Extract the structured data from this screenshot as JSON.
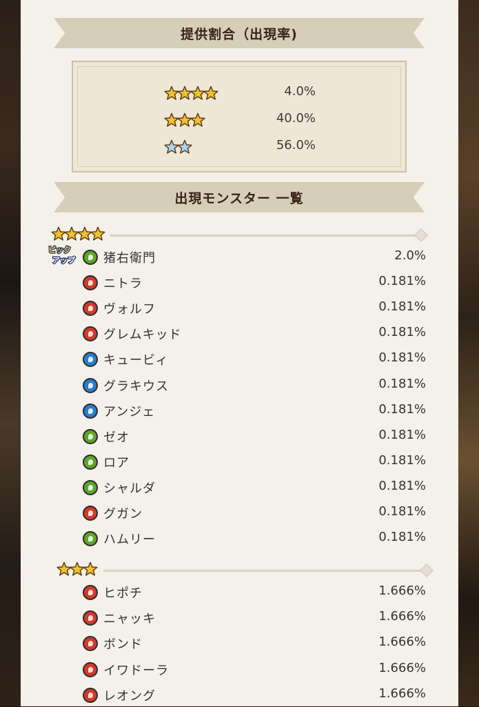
{
  "colors": {
    "panel": "#f4f1ea",
    "banner": "#d6ceb8",
    "fire": "#d23a2a",
    "water": "#2a7ec8",
    "wood": "#5ea62a",
    "gold_star": "#f0c030",
    "silver_star": "#c9c9c9",
    "blue_star": "#a8d4f2"
  },
  "rates_banner": {
    "title": "提供割合（出現率)"
  },
  "rates": [
    {
      "stars": 4,
      "star_color": "gold",
      "value": "4.0%"
    },
    {
      "stars": 3,
      "star_color": "gold",
      "value": "40.0%"
    },
    {
      "stars": 2,
      "star_color": "blue",
      "value": "56.0%"
    }
  ],
  "monsters_banner": {
    "title": "出現モンスター 一覧"
  },
  "four_star_section": {
    "stars": 4,
    "pickup_badge_text": [
      "ピック",
      "アップ"
    ],
    "monsters": [
      {
        "name": "猪右衛門",
        "attribute": "wood",
        "rate": "2.0%",
        "pickup": true
      },
      {
        "name": "ニトラ",
        "attribute": "fire",
        "rate": "0.181%"
      },
      {
        "name": "ヴォルフ",
        "attribute": "fire",
        "rate": "0.181%"
      },
      {
        "name": "グレムキッド",
        "attribute": "fire",
        "rate": "0.181%"
      },
      {
        "name": "キュービィ",
        "attribute": "water",
        "rate": "0.181%"
      },
      {
        "name": "グラキウス",
        "attribute": "water",
        "rate": "0.181%"
      },
      {
        "name": "アンジェ",
        "attribute": "water",
        "rate": "0.181%"
      },
      {
        "name": "ゼオ",
        "attribute": "wood",
        "rate": "0.181%"
      },
      {
        "name": "ロア",
        "attribute": "wood",
        "rate": "0.181%"
      },
      {
        "name": "シャルダ",
        "attribute": "wood",
        "rate": "0.181%"
      },
      {
        "name": "グガン",
        "attribute": "fire",
        "rate": "0.181%"
      },
      {
        "name": "ハムリー",
        "attribute": "wood",
        "rate": "0.181%"
      }
    ]
  },
  "three_star_section": {
    "stars": 3,
    "monsters": [
      {
        "name": "ヒポチ",
        "attribute": "fire",
        "rate": "1.666%"
      },
      {
        "name": "ニャッキ",
        "attribute": "fire",
        "rate": "1.666%"
      },
      {
        "name": "ボンド",
        "attribute": "fire",
        "rate": "1.666%"
      },
      {
        "name": "イワドーラ",
        "attribute": "fire",
        "rate": "1.666%"
      },
      {
        "name": "レオング",
        "attribute": "fire",
        "rate": "1.666%"
      }
    ]
  }
}
